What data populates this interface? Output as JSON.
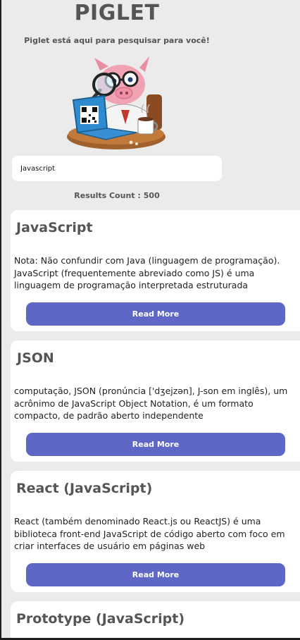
{
  "header": {
    "title": "PIGLET",
    "subtitle": "Piglet está aqui para pesquisar para você!"
  },
  "search": {
    "value": "Javascript"
  },
  "results": {
    "label": "Results Count :",
    "count": "500"
  },
  "cards": [
    {
      "title": "JavaScript",
      "text": " Nota: Não confundir com Java (linguagem de programação). JavaScript (frequentemente abreviado como JS) é uma linguagem de programação interpretada estruturada",
      "button": "Read More"
    },
    {
      "title": "JSON",
      "text": "computação, JSON (pronúncia ['dʒejzən], J-son em inglês), um acrônimo de JavaScript Object Notation, é um formato compacto, de padrão aberto independente",
      "button": "Read More"
    },
    {
      "title": "React (JavaScript)",
      "text": "React (também denominado React.js ou ReactJS) é uma biblioteca front-end JavaScript de código aberto com foco em criar interfaces de usuário em páginas web",
      "button": "Read More"
    },
    {
      "title": "Prototype (JavaScript)",
      "text": "",
      "button": ""
    }
  ],
  "colors": {
    "background": "#ebebeb",
    "card": "#ffffff",
    "accent_button": "#5e67c5",
    "heading": "#555555"
  },
  "icons": {
    "mascot": "pig-detective-with-magnifying-glass-and-laptop-illustration"
  }
}
